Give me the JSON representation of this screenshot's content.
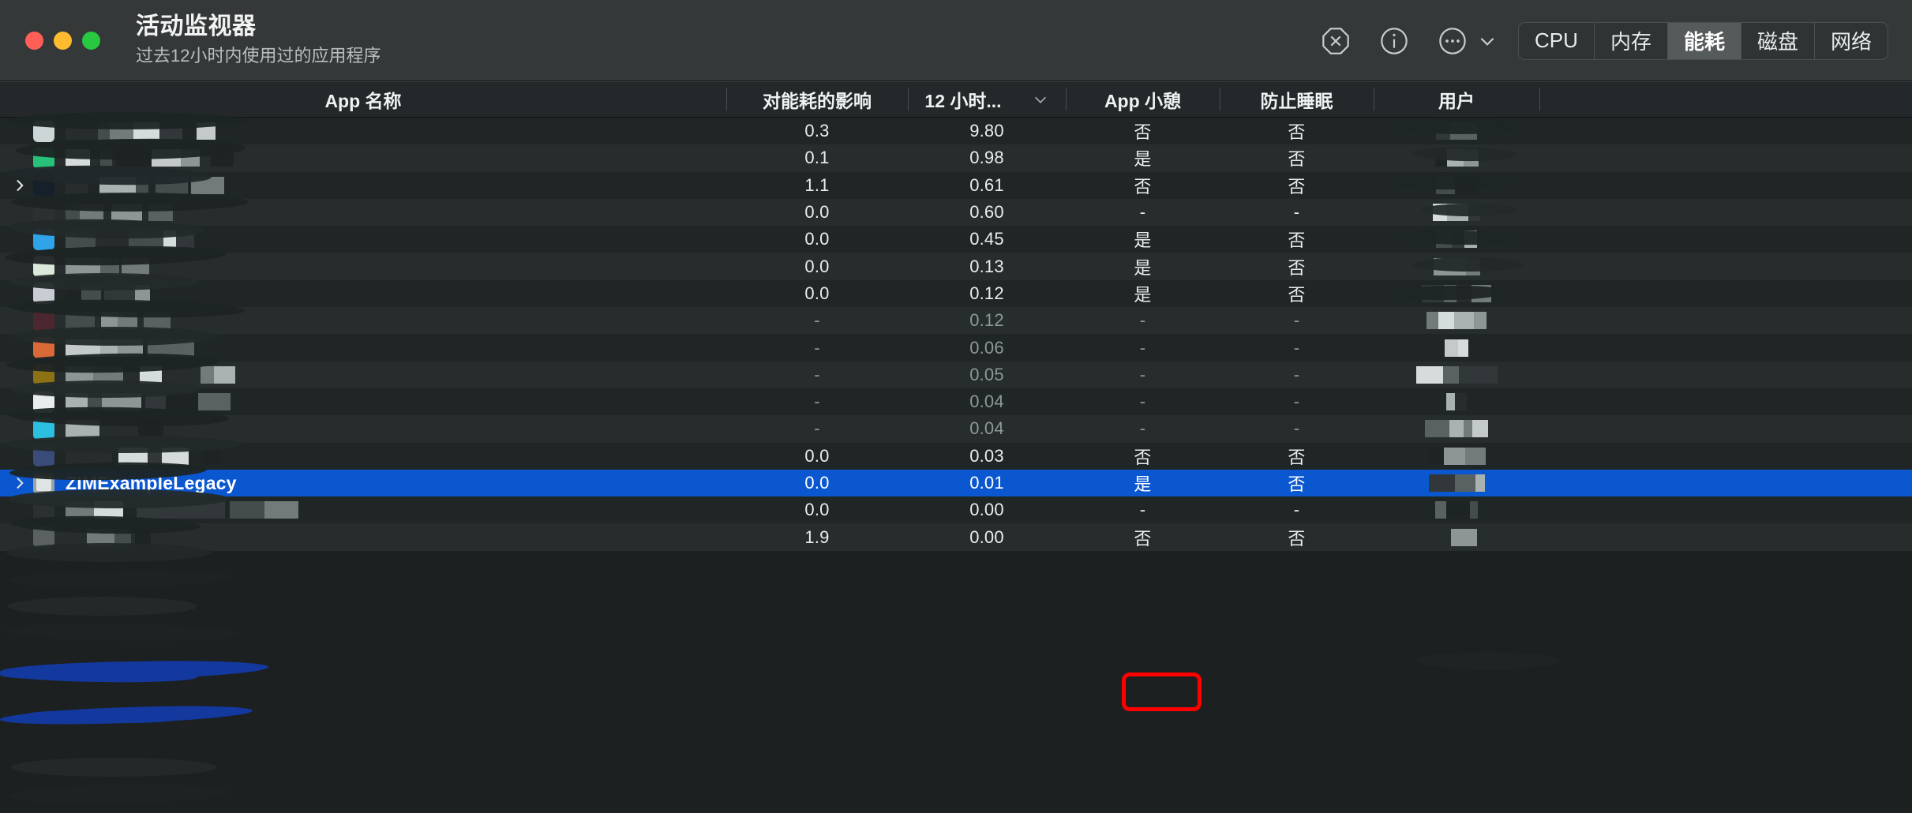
{
  "window": {
    "title": "活动监视器",
    "subtitle": "过去12小时内使用过的应用程序",
    "traffic_lights": [
      {
        "name": "close",
        "color": "#ff5f57"
      },
      {
        "name": "minimize",
        "color": "#febc2e"
      },
      {
        "name": "zoom",
        "color": "#28c840"
      }
    ]
  },
  "toolbar": {
    "icons": [
      {
        "name": "stop-process-icon",
        "glyph": "x-octagon"
      },
      {
        "name": "inspect-process-icon",
        "glyph": "info-circle"
      },
      {
        "name": "more-options-icon",
        "glyph": "ellipsis-circle"
      },
      {
        "name": "chevron-down-icon",
        "glyph": "chevron-down"
      }
    ],
    "tabs": [
      {
        "label": "CPU",
        "active": false
      },
      {
        "label": "内存",
        "active": false
      },
      {
        "label": "能耗",
        "active": true
      },
      {
        "label": "磁盘",
        "active": false
      },
      {
        "label": "网络",
        "active": false
      }
    ]
  },
  "table": {
    "columns": [
      {
        "key": "name",
        "label": "App 名称",
        "sortable": true,
        "sorted": false
      },
      {
        "key": "energy",
        "label": "对能耗的影响",
        "sortable": true,
        "sorted": false
      },
      {
        "key": "h12",
        "label": "12 小时...",
        "sortable": true,
        "sorted": true,
        "sort_dir": "desc"
      },
      {
        "key": "nap",
        "label": "App 小憩",
        "sortable": true,
        "sorted": false
      },
      {
        "key": "sleep",
        "label": "防止睡眠",
        "sortable": true,
        "sorted": false
      },
      {
        "key": "user",
        "label": "用户",
        "sortable": true,
        "sorted": false
      }
    ],
    "rows": [
      {
        "name": "",
        "redacted": true,
        "icon_color": "#ccd6d6",
        "expandable": false,
        "energy": "0.3",
        "h12": "9.80",
        "nap": "否",
        "sleep": "否",
        "user": "",
        "user_redacted": true,
        "dim": false,
        "selected": false
      },
      {
        "name": "",
        "redacted": true,
        "icon_color": "#27c178",
        "expandable": false,
        "energy": "0.1",
        "h12": "0.98",
        "nap": "是",
        "sleep": "否",
        "user": "",
        "user_redacted": true,
        "dim": false,
        "selected": false
      },
      {
        "name": "",
        "redacted": true,
        "icon_color": "#16202a",
        "expandable": true,
        "energy": "1.1",
        "h12": "0.61",
        "nap": "否",
        "sleep": "否",
        "user": "",
        "user_redacted": true,
        "dim": false,
        "selected": false
      },
      {
        "name": "",
        "redacted": true,
        "icon_color": "#2b3030",
        "expandable": false,
        "energy": "0.0",
        "h12": "0.60",
        "nap": "-",
        "sleep": "-",
        "user": "",
        "user_redacted": true,
        "dim": false,
        "selected": false
      },
      {
        "name": "",
        "redacted": true,
        "icon_color": "#2fa4e8",
        "expandable": false,
        "energy": "0.0",
        "h12": "0.45",
        "nap": "是",
        "sleep": "否",
        "user": "",
        "user_redacted": true,
        "dim": false,
        "selected": false
      },
      {
        "name": "",
        "redacted": true,
        "icon_color": "#dbe8da",
        "expandable": false,
        "energy": "0.0",
        "h12": "0.13",
        "nap": "是",
        "sleep": "否",
        "user": "",
        "user_redacted": true,
        "dim": false,
        "selected": false
      },
      {
        "name": "",
        "redacted": true,
        "icon_color": "#c9ccd2",
        "expandable": false,
        "energy": "0.0",
        "h12": "0.12",
        "nap": "是",
        "sleep": "否",
        "user": "",
        "user_redacted": true,
        "dim": false,
        "selected": false
      },
      {
        "name": "",
        "redacted": true,
        "icon_color": "#4d2730",
        "expandable": false,
        "energy": "-",
        "h12": "0.12",
        "nap": "-",
        "sleep": "-",
        "user": "",
        "user_redacted": true,
        "dim": true,
        "selected": false
      },
      {
        "name": "",
        "redacted": true,
        "icon_color": "#d96a37",
        "expandable": false,
        "energy": "-",
        "h12": "0.06",
        "nap": "-",
        "sleep": "-",
        "user": "",
        "user_redacted": true,
        "dim": true,
        "selected": false
      },
      {
        "name": "",
        "redacted": true,
        "icon_color": "#8c7214",
        "expandable": false,
        "energy": "-",
        "h12": "0.05",
        "nap": "-",
        "sleep": "-",
        "user": "",
        "user_redacted": true,
        "dim": true,
        "selected": false
      },
      {
        "name": "",
        "redacted": true,
        "icon_color": "#e9eded",
        "expandable": false,
        "energy": "-",
        "h12": "0.04",
        "nap": "-",
        "sleep": "-",
        "user": "",
        "user_redacted": true,
        "dim": true,
        "selected": false
      },
      {
        "name": "",
        "redacted": true,
        "icon_color": "#2bbfe0",
        "expandable": false,
        "energy": "-",
        "h12": "0.04",
        "nap": "-",
        "sleep": "-",
        "user": "",
        "user_redacted": true,
        "dim": true,
        "selected": false
      },
      {
        "name": "",
        "redacted": true,
        "icon_color": "#3a4d7a",
        "expandable": false,
        "energy": "0.0",
        "h12": "0.03",
        "nap": "否",
        "sleep": "否",
        "user": "",
        "user_redacted": true,
        "dim": false,
        "selected": false
      },
      {
        "name": "ZIMExampleLegacy",
        "redacted": false,
        "icon_color": "#e8eded",
        "expandable": true,
        "energy": "0.0",
        "h12": "0.01",
        "nap": "是",
        "sleep": "否",
        "user": "",
        "user_redacted": true,
        "dim": false,
        "selected": true
      },
      {
        "name": "",
        "redacted": true,
        "icon_color": "#2b3030",
        "expandable": false,
        "energy": "0.0",
        "h12": "0.00",
        "nap": "-",
        "sleep": "-",
        "user": "",
        "user_redacted": true,
        "dim": false,
        "selected": false
      },
      {
        "name": "",
        "redacted": true,
        "icon_color": "#5b6161",
        "expandable": false,
        "energy": "1.9",
        "h12": "0.00",
        "nap": "否",
        "sleep": "否",
        "user": "",
        "user_redacted": true,
        "dim": false,
        "selected": false
      }
    ]
  },
  "annotation": {
    "name": "red-highlight-box",
    "color": "#ff0000",
    "target_cell": "是",
    "target_column": "App 小憩",
    "target_row": "ZIMExampleLegacy"
  },
  "colors": {
    "titlebar_bg": "#353839",
    "row_odd": "#202626",
    "row_even": "#272d2d",
    "selection_blue": "#0b57d0",
    "header_bg": "#24282a",
    "text_primary": "#e8eded",
    "text_dim": "#8f9797"
  }
}
